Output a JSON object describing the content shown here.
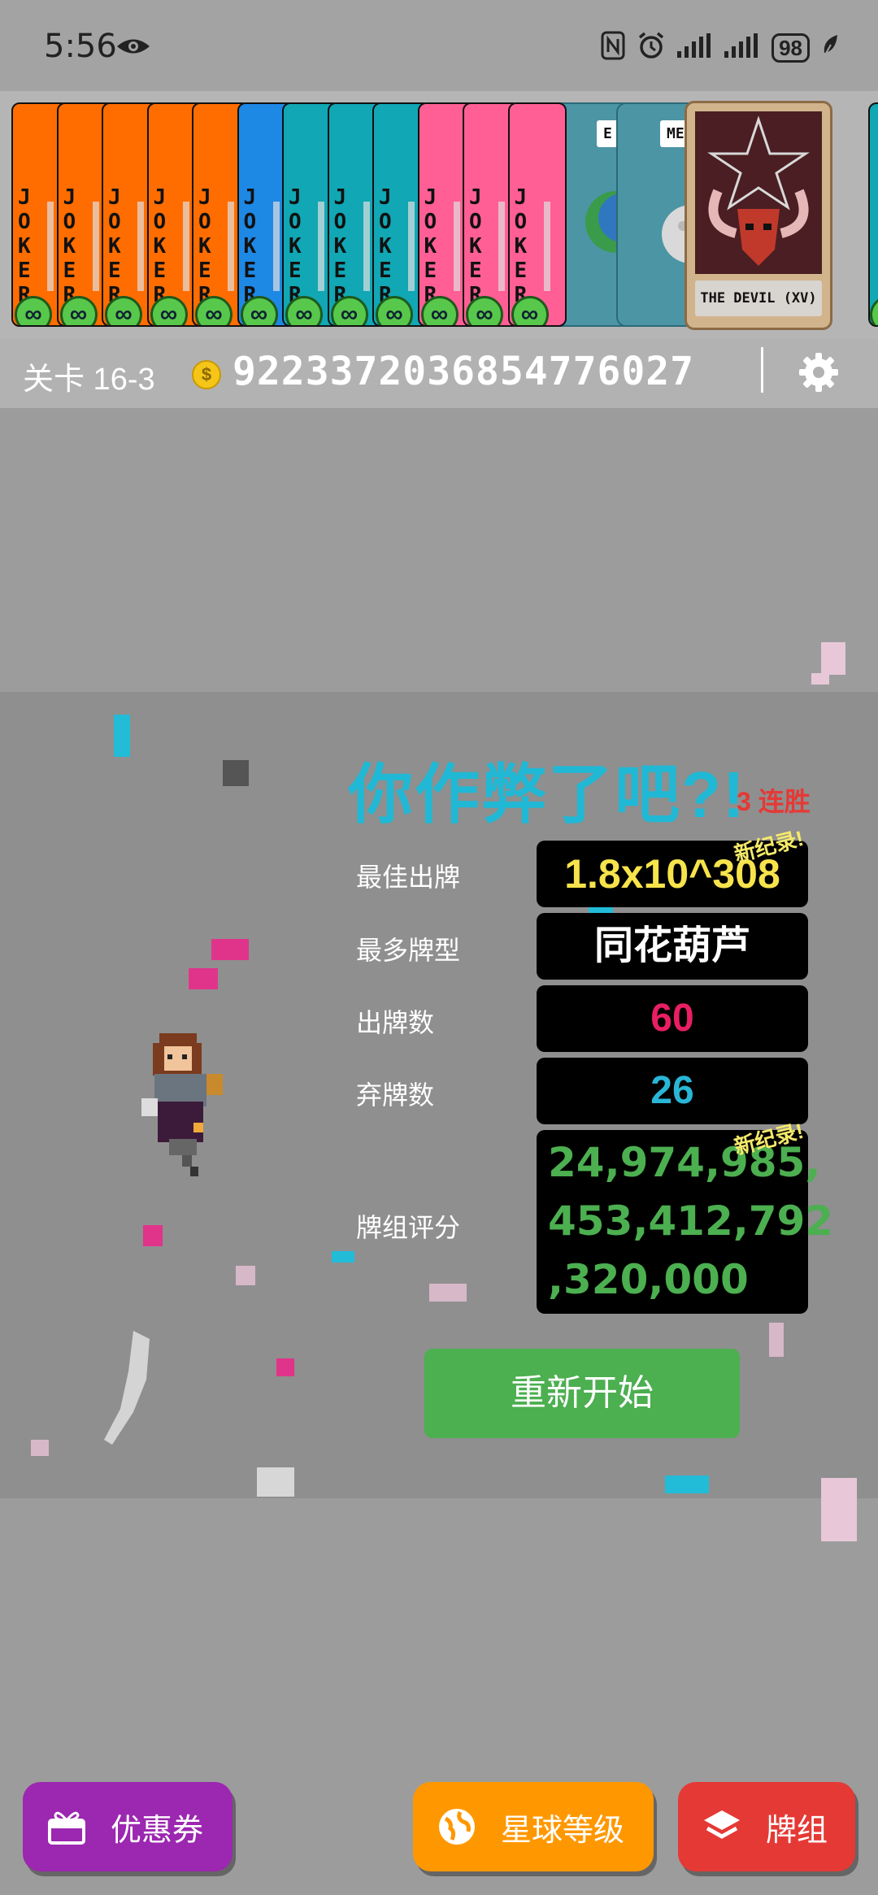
{
  "status_bar": {
    "time": "5:56",
    "battery": "98"
  },
  "card_strip": {
    "joker_text": "JOKER",
    "infinity": "∞",
    "planet_labels": [
      "E",
      "ME"
    ],
    "devil_card_name": "THE DEVIL (XV)",
    "colors": {
      "orange": "#ff6d00",
      "blue": "#1e88e5",
      "teal": "#11a7b4",
      "pink": "#ff5f95"
    }
  },
  "info_bar": {
    "level": "关卡 16-3",
    "coin_symbol": "$",
    "money": "9223372036854776027"
  },
  "result": {
    "title": "你作弊了吧?!",
    "streak": "3 连胜",
    "new_record": "新纪录!",
    "rows": [
      {
        "label": "最佳出牌",
        "value": "1.8x10^308",
        "color": "#f7e34b"
      },
      {
        "label": "最多牌型",
        "value": "同花葫芦",
        "color": "#ffffff"
      },
      {
        "label": "出牌数",
        "value": "60",
        "color": "#e91e63"
      },
      {
        "label": "弃牌数",
        "value": "26",
        "color": "#29b6d6"
      }
    ],
    "score_label": "牌组评分",
    "score_lines": [
      "24,974,985,",
      "453,412,792",
      ",320,000"
    ],
    "restart_label": "重新开始"
  },
  "bottom_nav": {
    "coupon_label": "优惠券",
    "planet_label": "星球等级",
    "deck_label": "牌组",
    "colors": {
      "coupon": "#9c27b0",
      "planet": "#ff9800",
      "deck": "#e53935"
    }
  }
}
